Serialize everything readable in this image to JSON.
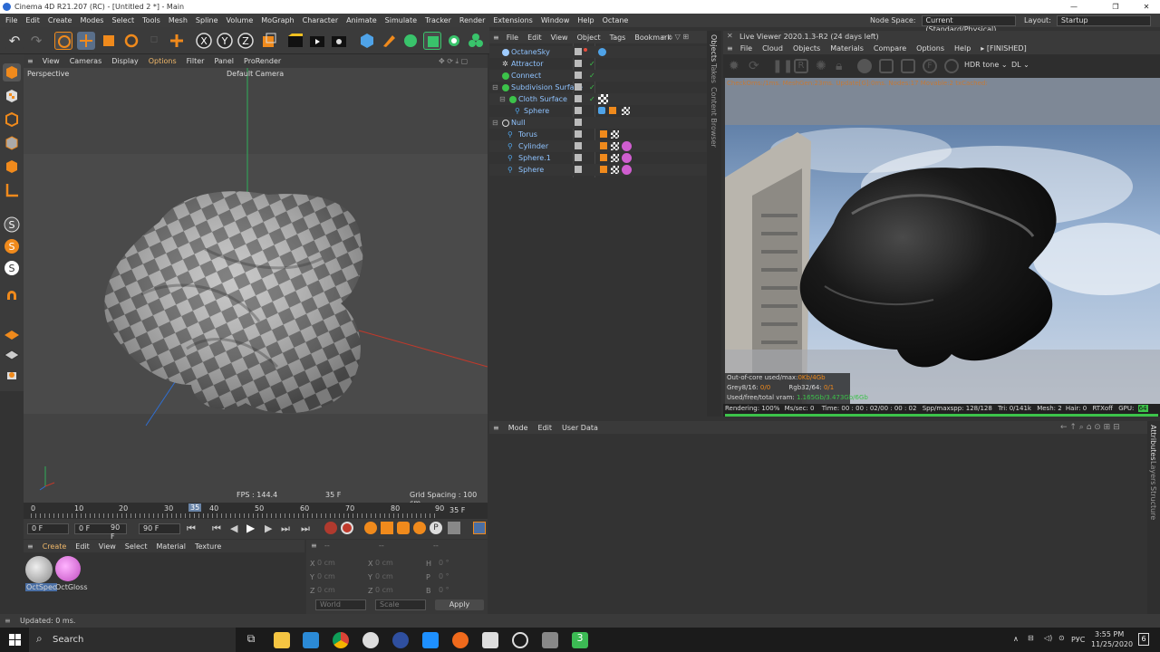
{
  "window": {
    "title": "Cinema 4D R21.207 (RC) - [Untitled 2 *] - Main"
  },
  "menu": [
    "File",
    "Edit",
    "Create",
    "Modes",
    "Select",
    "Tools",
    "Mesh",
    "Spline",
    "Volume",
    "MoGraph",
    "Character",
    "Animate",
    "Simulate",
    "Tracker",
    "Render",
    "Extensions",
    "Window",
    "Help",
    "Octane"
  ],
  "node_space": {
    "label": "Node Space:",
    "value": "Current (Standard/Physical)"
  },
  "layout": {
    "label": "Layout:",
    "value": "Startup"
  },
  "viewport": {
    "menu": [
      "View",
      "Cameras",
      "Display",
      "Options",
      "Filter",
      "Panel",
      "ProRender"
    ],
    "label": "Perspective",
    "camera": "Default Camera",
    "fps": "FPS : 144.4",
    "frame": "35 F",
    "grid": "Grid Spacing : 100 cm"
  },
  "timeline": {
    "ticks": [
      "0",
      "10",
      "20",
      "30",
      "35",
      "40",
      "50",
      "60",
      "70",
      "80",
      "90"
    ],
    "current_frame": "35 F",
    "current_value": 35
  },
  "transport": {
    "start": "0 F",
    "min": "0 F",
    "max": "90 F",
    "end": "90 F"
  },
  "materials": {
    "menu": [
      "Create",
      "Edit",
      "View",
      "Select",
      "Material",
      "Texture"
    ],
    "items": [
      {
        "name": "OctSpec"
      },
      {
        "name": "OctGloss"
      }
    ]
  },
  "coords": {
    "header": [
      "--",
      "--",
      "--"
    ],
    "rows": [
      {
        "a": "X",
        "v1": "0 cm",
        "b": "X",
        "v2": "0 cm",
        "c": "H",
        "v3": "0 °"
      },
      {
        "a": "Y",
        "v1": "0 cm",
        "b": "Y",
        "v2": "0 cm",
        "c": "P",
        "v3": "0 °"
      },
      {
        "a": "Z",
        "v1": "0 cm",
        "b": "Z",
        "v2": "0 cm",
        "c": "B",
        "v3": "0 °"
      }
    ],
    "space": "World",
    "mode": "Scale",
    "apply": "Apply"
  },
  "status": "Updated: 0 ms.",
  "objects": {
    "menu": [
      "File",
      "Edit",
      "View",
      "Object",
      "Tags",
      "Bookmark"
    ],
    "rows": [
      {
        "name": "OctaneSky",
        "indent": 0
      },
      {
        "name": "Attractor",
        "indent": 0
      },
      {
        "name": "Connect",
        "indent": 0
      },
      {
        "name": "Subdivision Surface",
        "indent": 0
      },
      {
        "name": "Cloth Surface",
        "indent": 1
      },
      {
        "name": "Sphere",
        "indent": 2
      },
      {
        "name": "Null",
        "indent": 0
      },
      {
        "name": "Torus",
        "indent": 1
      },
      {
        "name": "Cylinder",
        "indent": 1
      },
      {
        "name": "Sphere.1",
        "indent": 1
      },
      {
        "name": "Sphere",
        "indent": 1
      }
    ]
  },
  "side_tabs": [
    "Objects",
    "Takes",
    "Content Browser"
  ],
  "right_tabs": [
    "Attributes",
    "Layers",
    "Structure"
  ],
  "live_viewer": {
    "title": "Live Viewer 2020.1.3-R2 (24 days left)",
    "menu": [
      "File",
      "Cloud",
      "Objects",
      "Materials",
      "Compare",
      "Options",
      "Help"
    ],
    "state": "[FINISHED]",
    "tonemap": "HDR tone",
    "kernel": "DL",
    "info_line": "CheckOms:/1ms. MeshGen:23ms. Update[G]:0ms. Nodes:17 Movable:2 txCached:",
    "ooc_label": "Out-of-core used/max:",
    "ooc_value": "0Kb/4Gb",
    "grey_label": "Grey8/16:",
    "grey_value": "0/0",
    "rgb_label": "Rgb32/64:",
    "rgb_value": "0/1",
    "vram_label": "Used/free/total vram:",
    "vram_value": "1.165Gb/3.473Gb/6Gb",
    "status_items": [
      "Rendering: 100%",
      "Ms/sec: 0",
      "Time: 00 : 00 : 02/00 : 00 : 02",
      "Spp/maxspp: 128/128",
      "Tri: 0/141k",
      "Mesh: 2",
      "Hair: 0",
      "RTXoff",
      "GPU:",
      "64"
    ],
    "progress": 1.0
  },
  "attributes": {
    "menu": [
      "Mode",
      "Edit",
      "User Data"
    ]
  },
  "taskbar": {
    "search": "Search",
    "lang": "РУС",
    "time": "3:55 PM",
    "date": "11/25/2020",
    "notifications": "6"
  },
  "colors": {
    "accent": "#2b6ad3",
    "selection": "#8fc3ff",
    "octane_orange": "#f08a1c",
    "progress_green": "#3cc34a"
  }
}
